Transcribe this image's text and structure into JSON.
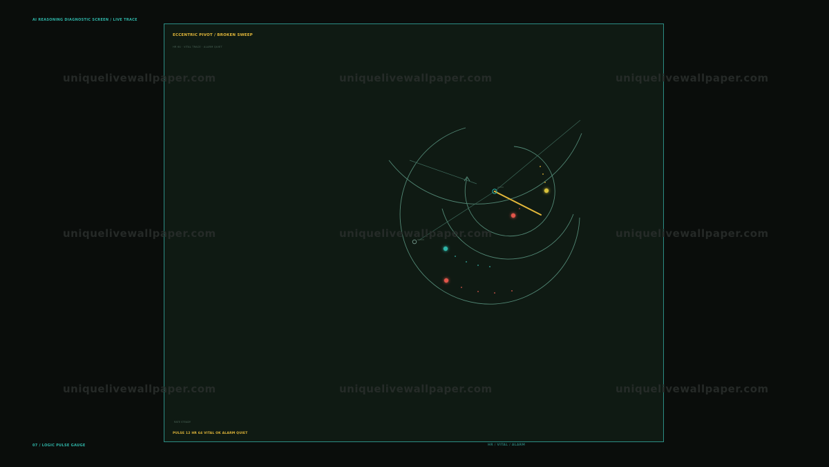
{
  "header": {
    "top_left": "AI REASONING DIAGNOSTIC SCREEN / LIVE TRACE",
    "bottom_left": "07 / LOGIC PULSE GAUGE",
    "bottom_mid": "HR / VITAL / ALARM"
  },
  "panel": {
    "title": "ECCENTRIC PIVOT / BROKEN SWEEP",
    "subtitle": "HR 64 · VITAL TRACE · ALARM QUIET",
    "foot_small": "RATE STEADY",
    "foot": "PULSE 12   HR 64   VITAL OK   ALARM QUIET"
  },
  "gauge": {
    "pivot_label": "pivot",
    "accent": "#e3b83a",
    "ring_color": "#5f9d88",
    "teal": "#2fb5a8",
    "red": "#e0554a",
    "yellow": "#d8c13a"
  },
  "watermarks": [
    "uniquelivewallpaper.com",
    "uniquelivewallpaper.com",
    "uniquelivewallpaper.com",
    "uniquelivewallpaper.com",
    "uniquelivewallpaper.com",
    "uniquelivewallpaper.com",
    "uniquelivewallpaper.com",
    "uniquelivewallpaper.com",
    "uniquelivewallpaper.com"
  ]
}
